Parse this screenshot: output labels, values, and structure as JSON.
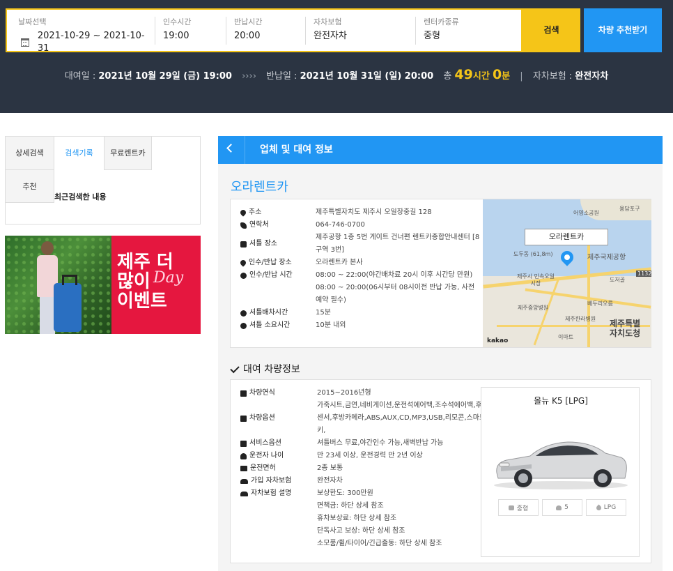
{
  "search": {
    "date_label": "날짜선택",
    "date_value": "2021-10-29 ~ 2021-10-31",
    "pickup_label": "인수시간",
    "pickup_value": "19:00",
    "return_label": "반납시간",
    "return_value": "20:00",
    "insurance_label": "자차보험",
    "insurance_value": "완전자차",
    "cartype_label": "렌터카종류",
    "cartype_value": "중형",
    "search_button": "검색",
    "recommend_button": "차량 추천받기"
  },
  "summary": {
    "rent_label": "대여일 :",
    "rent_value": "2021년 10월 29일 (금) 19:00",
    "arrow": "››››",
    "return_label": "반납일 :",
    "return_value": "2021년 10월 31일 (일) 20:00",
    "total_label": "총",
    "hours": "49",
    "hours_unit": "시간",
    "minutes": "0",
    "minutes_unit": "분",
    "divider": "|",
    "insurance_label": "자차보험 :",
    "insurance_value": "완전자차"
  },
  "left_tabs": {
    "tab1": "상세검색",
    "tab2": "검색기록",
    "tab3": "무료렌트카",
    "tab4": "추천",
    "recent_label": "최근검색한 내용"
  },
  "banner": {
    "line1": "제주 더",
    "line2": "많이",
    "line3": "이벤트",
    "day": "Day"
  },
  "panel": {
    "title": "업체 및 대여 정보",
    "company": "오라렌트카",
    "info": [
      {
        "key": "주소",
        "value": "제주특별자치도 제주시 오일장중길 128"
      },
      {
        "key": "연락처",
        "value": "064-746-0700"
      },
      {
        "key": "셔틀 장소",
        "value": "제주공항 1층 5번 게이트 건너편 렌트카종합안내센터 [8구역 3번]"
      },
      {
        "key": "인수/반납 장소",
        "value": "오라렌트카 본사"
      },
      {
        "key": "인수/반납 시간",
        "value": "08:00 ~ 22:00(야간배차료 20시 이후 시간당 만원)"
      },
      {
        "key": "",
        "value": "08:00 ~ 20:00(06시부터 08시이전 반납 가능, 사전예약 필수)"
      },
      {
        "key": "셔틀배차시간",
        "value": "15분"
      },
      {
        "key": "셔틀 소요시간",
        "value": "10분 내외"
      }
    ],
    "map": {
      "callout": "오라렌트카",
      "labels": [
        "용담포구",
        "어영소공원",
        "도두동 (61,8m)",
        "제주국제공항",
        "제주시 민속오일시장",
        "도저골",
        "제주중앙병원",
        "베두리오름",
        "제주한라병원",
        "이마트",
        "1132"
      ],
      "big_label_1": "제주특별",
      "big_label_2": "자치도청",
      "kakao": "kakao"
    },
    "vehicle_section_title": "대여 차량정보",
    "vehicle": [
      {
        "key": "차량연식",
        "value": "2015~2016년형"
      },
      {
        "key": "차량옵션",
        "value": "가죽시트,금연,네비게이션,운전석에어백,조수석에어백,후방센서,후방카메라,ABS,AUX,CD,MP3,USB,리모콘,스마트키,"
      },
      {
        "key": "서비스옵션",
        "value": "셔틀버스 무료,야간인수 가능,새벽반납 가능"
      },
      {
        "key": "운전자 나이",
        "value": "만 23세 이상, 운전경력 만 2년 이상"
      },
      {
        "key": "운전면허",
        "value": "2종 보통"
      },
      {
        "key": "가입 자차보험",
        "value": "완전자차"
      },
      {
        "key": "자차보험 설명",
        "value": "보상한도: 300만원"
      },
      {
        "key": "",
        "value": "면책금: 하단 상세 참조"
      },
      {
        "key": "",
        "value": "휴차보상료: 하단 상세 참조"
      },
      {
        "key": "",
        "value": "단독사고 보상: 하단 상세 참조"
      },
      {
        "key": "",
        "value": "소모품/휠/타이어/긴급출동: 하단 상세 참조"
      }
    ],
    "car": {
      "name": "올뉴 K5 [LPG]",
      "size": "중형",
      "seats": "5",
      "fuel": "LPG"
    }
  },
  "colors": {
    "header_bg": "#2b3442",
    "accent_yellow": "#f5c518",
    "accent_blue": "#2196f3"
  }
}
